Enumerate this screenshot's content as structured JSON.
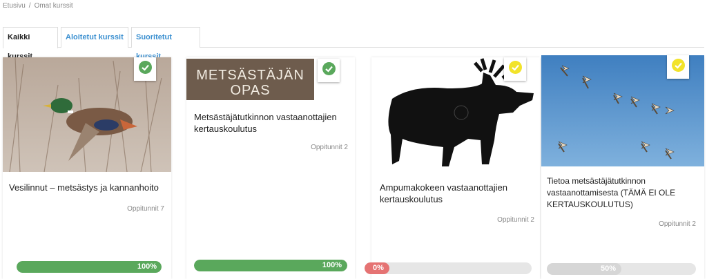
{
  "breadcrumb": {
    "home": "Etusivu",
    "separator": "/",
    "current": "Omat kurssit"
  },
  "tabs": [
    {
      "label": "Kaikki kurssit"
    },
    {
      "label": "Aloitetut kurssit"
    },
    {
      "label": "Suoritetut kurssit"
    }
  ],
  "colors": {
    "green": "#5aa85c",
    "yellow": "#f2e32a",
    "red": "#e57373",
    "grey": "#d6d6d6",
    "link": "#3a8fd0"
  },
  "courses": [
    {
      "title": "Vesilinnut – metsästys ja kannanhoito",
      "lessons": "Oppitunnit 7",
      "progress_label": "100%",
      "progress": 1.0,
      "status": "completed",
      "image": "duck-image"
    },
    {
      "title": "Metsästäjätutkinnon vastaanottajien kertauskoulutus",
      "lessons": "Oppitunnit 2",
      "progress_label": "100%",
      "progress": 1.0,
      "status": "completed",
      "image": "guide-logo",
      "image_text_line1": "METSÄSTÄJÄN",
      "image_text_line2": "OPAS"
    },
    {
      "title": "Ampumakokeen vastaanottajien kertauskoulutus",
      "lessons": "Oppitunnit 2",
      "progress_label": "0%",
      "progress": 0.0,
      "status": "in-progress",
      "image": "moose-target-image"
    },
    {
      "title": "Tietoa metsästäjätutkinnon vastaanottamisesta (TÄMÄ EI OLE KERTAUSKOULUTUS)",
      "lessons": "Oppitunnit 2",
      "progress_label": "50%",
      "progress": 0.5,
      "status": "in-progress",
      "image": "geese-image"
    }
  ]
}
